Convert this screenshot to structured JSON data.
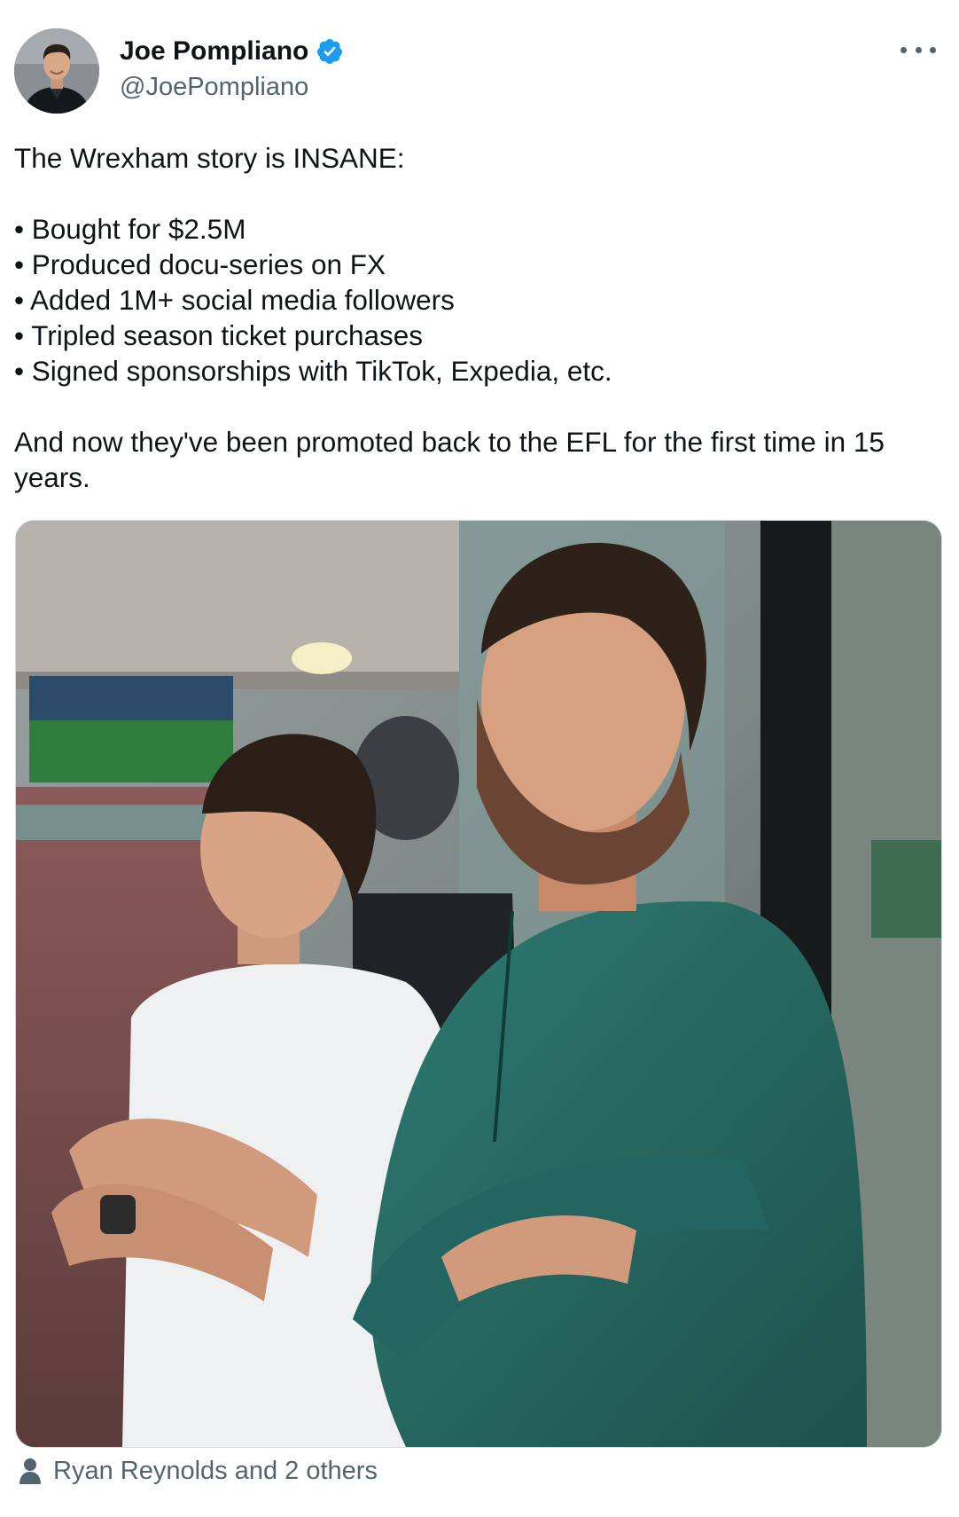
{
  "author": {
    "name": "Joe Pompliano",
    "handle": "@JoePompliano",
    "verified": true,
    "verified_color": "#1d9bf0"
  },
  "tweet": {
    "intro": "The Wrexham story is INSANE:",
    "bullets": [
      "Bought for $2.5M",
      "Produced docu-series on FX",
      "Added 1M+ social media followers",
      "Tripled season ticket purchases",
      "Signed sponsorships with TikTok, Expedia, etc."
    ],
    "closing": "And now they've been promoted back to the EFL for the first time in 15 years."
  },
  "media": {
    "tagged_label": "Ryan Reynolds and 2 others"
  },
  "icons": {
    "more": "more-horizontal-icon",
    "verified": "verified-badge-icon",
    "tagged": "person-icon"
  },
  "colors": {
    "text": "#0f1419",
    "secondary_text": "#536471",
    "border": "#cfd9de"
  }
}
